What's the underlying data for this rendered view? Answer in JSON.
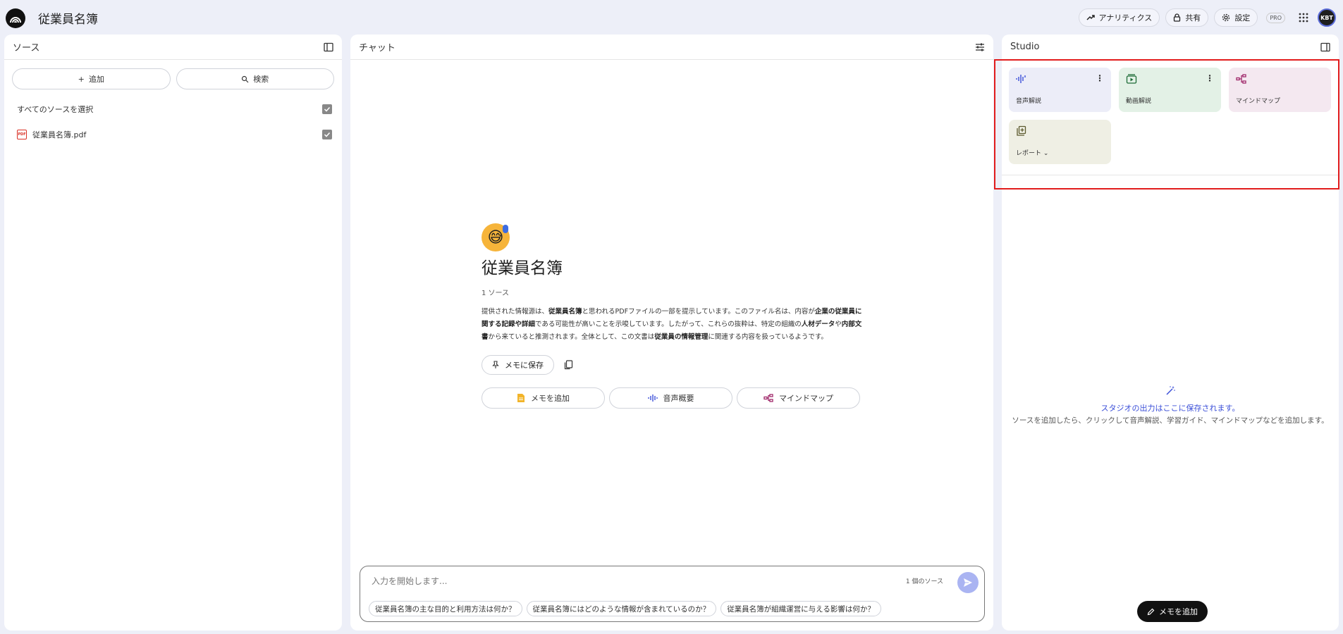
{
  "app": {
    "title": "従業員名簿",
    "analytics_label": "アナリティクス",
    "share_label": "共有",
    "settings_label": "設定",
    "pro_label": "PRO",
    "avatar_initials": "KBT"
  },
  "sources": {
    "header": "ソース",
    "add_label": "追加",
    "search_label": "検索",
    "select_all_label": "すべてのソースを選択",
    "items": [
      {
        "name": "従業員名簿.pdf",
        "type": "pdf-icon"
      }
    ]
  },
  "chat": {
    "header": "チャット",
    "notebook_title": "従業員名簿",
    "source_count": "1 ソース",
    "summary_parts": [
      "提供された情報源は、",
      "従業員名簿",
      "と思われるPDFファイルの一部を提示しています。このファイル名は、内容が",
      "企業の従業員に関する記録や詳細",
      "である可能性が高いことを示唆しています。したがって、これらの抜粋は、特定の組織の",
      "人材データ",
      "や",
      "内部文書",
      "から来ていると推測されます。全体として、この文書は",
      "従業員の情報管理",
      "に関連する内容を扱っているようです。"
    ],
    "save_memo_label": "メモに保存",
    "add_memo_label": "メモを追加",
    "audio_overview_label": "音声概要",
    "mindmap_label": "マインドマップ",
    "input_placeholder": "入力を開始します...",
    "composer_source_count": "1 個のソース",
    "suggestions": [
      "従業員名簿の主な目的と利用方法は何か？",
      "従業員名簿にはどのような情報が含まれているのか？",
      "従業員名簿が組織運営に与える影響は何か？"
    ]
  },
  "studio": {
    "header": "Studio",
    "tiles": [
      {
        "label": "音声解説",
        "color": "#ecedf8",
        "icon": "audio-waveform-icon",
        "has_more": true
      },
      {
        "label": "動画解説",
        "color": "#e3f1e6",
        "icon": "video-icon",
        "has_more": true
      },
      {
        "label": "マインドマップ",
        "color": "#f4e8f0",
        "icon": "mindmap-icon",
        "has_more": false
      },
      {
        "label": "レポート",
        "color": "#efefe4",
        "icon": "report-icon",
        "has_more": false
      }
    ],
    "empty_title": "スタジオの出力はここに保存されます。",
    "empty_subtitle": "ソースを追加したら、クリックして音声解説、学習ガイド、マインドマップなどを追加します。",
    "add_note_label": "メモを追加"
  },
  "colors": {
    "accent": "#3b4fd8",
    "highlight": "#e21c1c",
    "background": "#edeff8"
  }
}
